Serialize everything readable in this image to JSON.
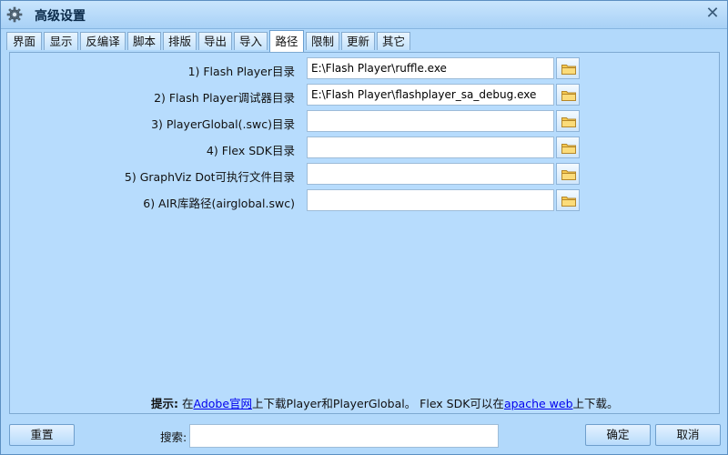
{
  "window": {
    "title": "高级设置"
  },
  "tabs": [
    {
      "label": "界面"
    },
    {
      "label": "显示"
    },
    {
      "label": "反编译"
    },
    {
      "label": "脚本"
    },
    {
      "label": "排版"
    },
    {
      "label": "导出"
    },
    {
      "label": "导入"
    },
    {
      "label": "路径",
      "active": true
    },
    {
      "label": "限制"
    },
    {
      "label": "更新"
    },
    {
      "label": "其它"
    }
  ],
  "paths": [
    {
      "label": "1) Flash Player目录",
      "value": "E:\\Flash Player\\ruffle.exe"
    },
    {
      "label": "2) Flash Player调试器目录",
      "value": "E:\\Flash Player\\flashplayer_sa_debug.exe"
    },
    {
      "label": "3) PlayerGlobal(.swc)目录",
      "value": ""
    },
    {
      "label": "4) Flex SDK目录",
      "value": ""
    },
    {
      "label": "5) GraphViz Dot可执行文件目录",
      "value": ""
    },
    {
      "label": "6) AIR库路径(airglobal.swc)",
      "value": ""
    }
  ],
  "hint": {
    "prefix": "提示:",
    "t1": " 在",
    "link1": "Adobe官网",
    "t2": "上下载Player和PlayerGlobal。 Flex SDK可以在",
    "link2": "apache web",
    "t3": "上下载。"
  },
  "footer": {
    "reset": "重置",
    "search_label": "搜索:",
    "search_value": "",
    "ok": "确定",
    "cancel": "取消"
  }
}
